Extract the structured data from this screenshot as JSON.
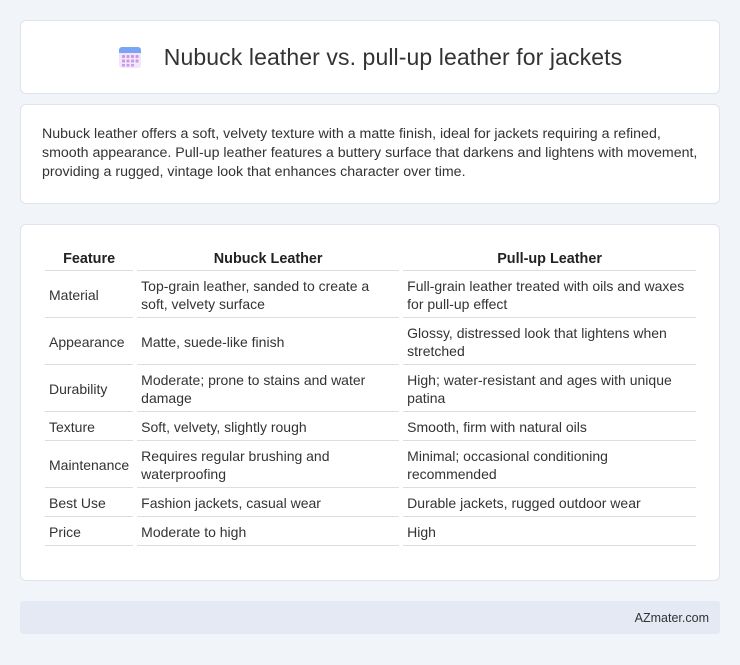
{
  "header": {
    "title": "Nubuck leather vs. pull-up leather for jackets",
    "icon": "calendar-icon",
    "icon_colors": {
      "top": "#7aa4f5",
      "grid": "#c79be8"
    }
  },
  "intro": {
    "text": "Nubuck leather offers a soft, velvety texture with a matte finish, ideal for jackets requiring a refined, smooth appearance. Pull-up leather features a buttery surface that darkens and lightens with movement, providing a rugged, vintage look that enhances character over time."
  },
  "table": {
    "headers": [
      "Feature",
      "Nubuck Leather",
      "Pull-up Leather"
    ],
    "rows": [
      [
        "Material",
        "Top-grain leather, sanded to create a soft, velvety surface",
        "Full-grain leather treated with oils and waxes for pull-up effect"
      ],
      [
        "Appearance",
        "Matte, suede-like finish",
        "Glossy, distressed look that lightens when stretched"
      ],
      [
        "Durability",
        "Moderate; prone to stains and water damage",
        "High; water-resistant and ages with unique patina"
      ],
      [
        "Texture",
        "Soft, velvety, slightly rough",
        "Smooth, firm with natural oils"
      ],
      [
        "Maintenance",
        "Requires regular brushing and waterproofing",
        "Minimal; occasional conditioning recommended"
      ],
      [
        "Best Use",
        "Fashion jackets, casual wear",
        "Durable jackets, rugged outdoor wear"
      ],
      [
        "Price",
        "Moderate to high",
        "High"
      ]
    ]
  },
  "footer": {
    "brand": "AZmater.com"
  }
}
